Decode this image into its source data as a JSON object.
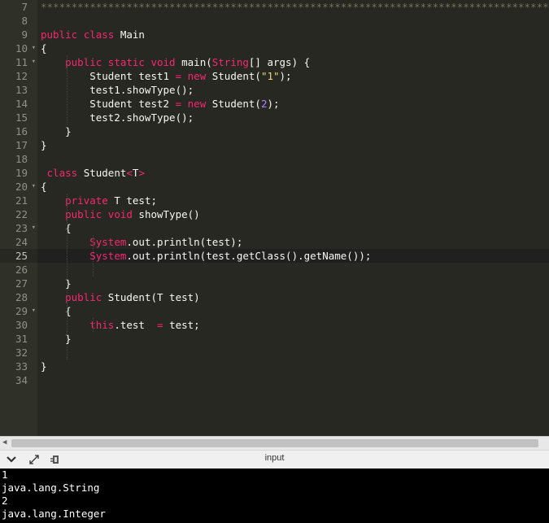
{
  "editor": {
    "lines": [
      {
        "n": "7",
        "fold": false,
        "active": false,
        "tokens": [
          [
            "cmt",
            "*************************************************************************************************"
          ]
        ]
      },
      {
        "n": "8",
        "fold": false,
        "active": false,
        "tokens": []
      },
      {
        "n": "9",
        "fold": false,
        "active": false,
        "tokens": [
          [
            "kw",
            "public"
          ],
          [
            "",
            ""
          ],
          [
            "pl",
            " "
          ],
          [
            "kw",
            "class"
          ],
          [
            "pl",
            " Main"
          ]
        ]
      },
      {
        "n": "10",
        "fold": true,
        "active": false,
        "tokens": [
          [
            "pl",
            "{"
          ]
        ]
      },
      {
        "n": "11",
        "fold": true,
        "active": false,
        "tokens": [
          [
            "pl",
            "    "
          ],
          [
            "kw",
            "public"
          ],
          [
            "pl",
            " "
          ],
          [
            "kw",
            "static"
          ],
          [
            "pl",
            " "
          ],
          [
            "kw",
            "void"
          ],
          [
            "pl",
            " main("
          ],
          [
            "sys",
            "String"
          ],
          [
            "pl",
            "[] args) {"
          ]
        ]
      },
      {
        "n": "12",
        "fold": false,
        "active": false,
        "tokens": [
          [
            "pl",
            "        Student test1 "
          ],
          [
            "kw",
            "="
          ],
          [
            "pl",
            " "
          ],
          [
            "kw",
            "new"
          ],
          [
            "pl",
            " Student("
          ],
          [
            "str",
            "\"1\""
          ],
          [
            "pl",
            ");"
          ]
        ]
      },
      {
        "n": "13",
        "fold": false,
        "active": false,
        "tokens": [
          [
            "pl",
            "        test1.showType();"
          ]
        ]
      },
      {
        "n": "14",
        "fold": false,
        "active": false,
        "tokens": [
          [
            "pl",
            "        Student test2 "
          ],
          [
            "kw",
            "="
          ],
          [
            "pl",
            " "
          ],
          [
            "kw",
            "new"
          ],
          [
            "pl",
            " Student("
          ],
          [
            "numl",
            "2"
          ],
          [
            "pl",
            ");"
          ]
        ]
      },
      {
        "n": "15",
        "fold": false,
        "active": false,
        "tokens": [
          [
            "pl",
            "        test2.showType();"
          ]
        ]
      },
      {
        "n": "16",
        "fold": false,
        "active": false,
        "tokens": [
          [
            "pl",
            "    }"
          ]
        ]
      },
      {
        "n": "17",
        "fold": false,
        "active": false,
        "tokens": [
          [
            "pl",
            "}"
          ]
        ]
      },
      {
        "n": "18",
        "fold": false,
        "active": false,
        "tokens": []
      },
      {
        "n": "19",
        "fold": false,
        "active": false,
        "tokens": [
          [
            "pl",
            " "
          ],
          [
            "kw",
            "class"
          ],
          [
            "pl",
            " Student"
          ],
          [
            "kw",
            "<"
          ],
          [
            "pl",
            "T"
          ],
          [
            "kw",
            ">"
          ]
        ]
      },
      {
        "n": "20",
        "fold": true,
        "active": false,
        "tokens": [
          [
            "pl",
            "{"
          ]
        ]
      },
      {
        "n": "21",
        "fold": false,
        "active": false,
        "tokens": [
          [
            "pl",
            "    "
          ],
          [
            "kw",
            "private"
          ],
          [
            "pl",
            " T test;"
          ]
        ]
      },
      {
        "n": "22",
        "fold": false,
        "active": false,
        "tokens": [
          [
            "pl",
            "    "
          ],
          [
            "kw",
            "public"
          ],
          [
            "pl",
            " "
          ],
          [
            "kw",
            "void"
          ],
          [
            "pl",
            " showType()"
          ]
        ]
      },
      {
        "n": "23",
        "fold": true,
        "active": false,
        "tokens": [
          [
            "pl",
            "    {"
          ]
        ]
      },
      {
        "n": "24",
        "fold": false,
        "active": false,
        "tokens": [
          [
            "pl",
            "        "
          ],
          [
            "sys",
            "System"
          ],
          [
            "pl",
            ".out.println(test);"
          ]
        ]
      },
      {
        "n": "25",
        "fold": false,
        "active": true,
        "tokens": [
          [
            "pl",
            "        "
          ],
          [
            "sys",
            "System"
          ],
          [
            "pl",
            ".out.println(test.getClass().getName());"
          ]
        ]
      },
      {
        "n": "26",
        "fold": false,
        "active": false,
        "tokens": []
      },
      {
        "n": "27",
        "fold": false,
        "active": false,
        "tokens": [
          [
            "pl",
            "    }"
          ]
        ]
      },
      {
        "n": "28",
        "fold": false,
        "active": false,
        "tokens": [
          [
            "pl",
            "    "
          ],
          [
            "kw",
            "public"
          ],
          [
            "pl",
            " Student(T test)"
          ]
        ]
      },
      {
        "n": "29",
        "fold": true,
        "active": false,
        "tokens": [
          [
            "pl",
            "    {"
          ]
        ]
      },
      {
        "n": "30",
        "fold": false,
        "active": false,
        "tokens": [
          [
            "pl",
            "        "
          ],
          [
            "kw",
            "this"
          ],
          [
            "pl",
            ".test  "
          ],
          [
            "kw",
            "="
          ],
          [
            "pl",
            " test;"
          ]
        ]
      },
      {
        "n": "31",
        "fold": false,
        "active": false,
        "tokens": [
          [
            "pl",
            "    }"
          ]
        ]
      },
      {
        "n": "32",
        "fold": false,
        "active": false,
        "tokens": []
      },
      {
        "n": "33",
        "fold": false,
        "active": false,
        "tokens": [
          [
            "pl",
            "}"
          ]
        ]
      },
      {
        "n": "34",
        "fold": false,
        "active": false,
        "tokens": []
      }
    ]
  },
  "toolbar": {
    "label": "input",
    "icons": [
      "chevron-down-icon",
      "expand-icon",
      "run-icon"
    ]
  },
  "console": {
    "output": [
      "1",
      "java.lang.String",
      "2",
      "java.lang.Integer"
    ]
  },
  "colors": {
    "editor_bg": "#272822",
    "gutter_bg": "#2f3129",
    "keyword": "#f92672",
    "string": "#e6db74",
    "number": "#ae81ff",
    "comment": "#75715e",
    "text": "#f8f8f2"
  }
}
